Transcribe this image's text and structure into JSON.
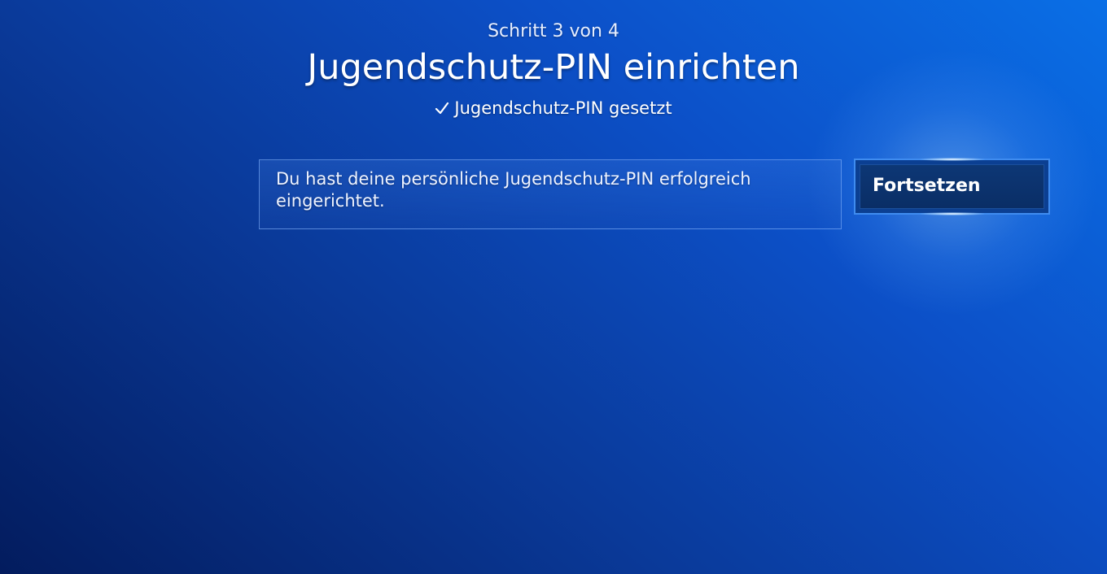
{
  "header": {
    "step": "Schritt 3 von 4",
    "title": "Jugendschutz-PIN einrichten",
    "status": "Jugendschutz-PIN gesetzt"
  },
  "message": {
    "text": "Du hast deine persönliche Jugendschutz-PIN erfolgreich eingerichtet."
  },
  "actions": {
    "continue_label": "Fortsetzen"
  },
  "icons": {
    "status": "check-icon"
  }
}
